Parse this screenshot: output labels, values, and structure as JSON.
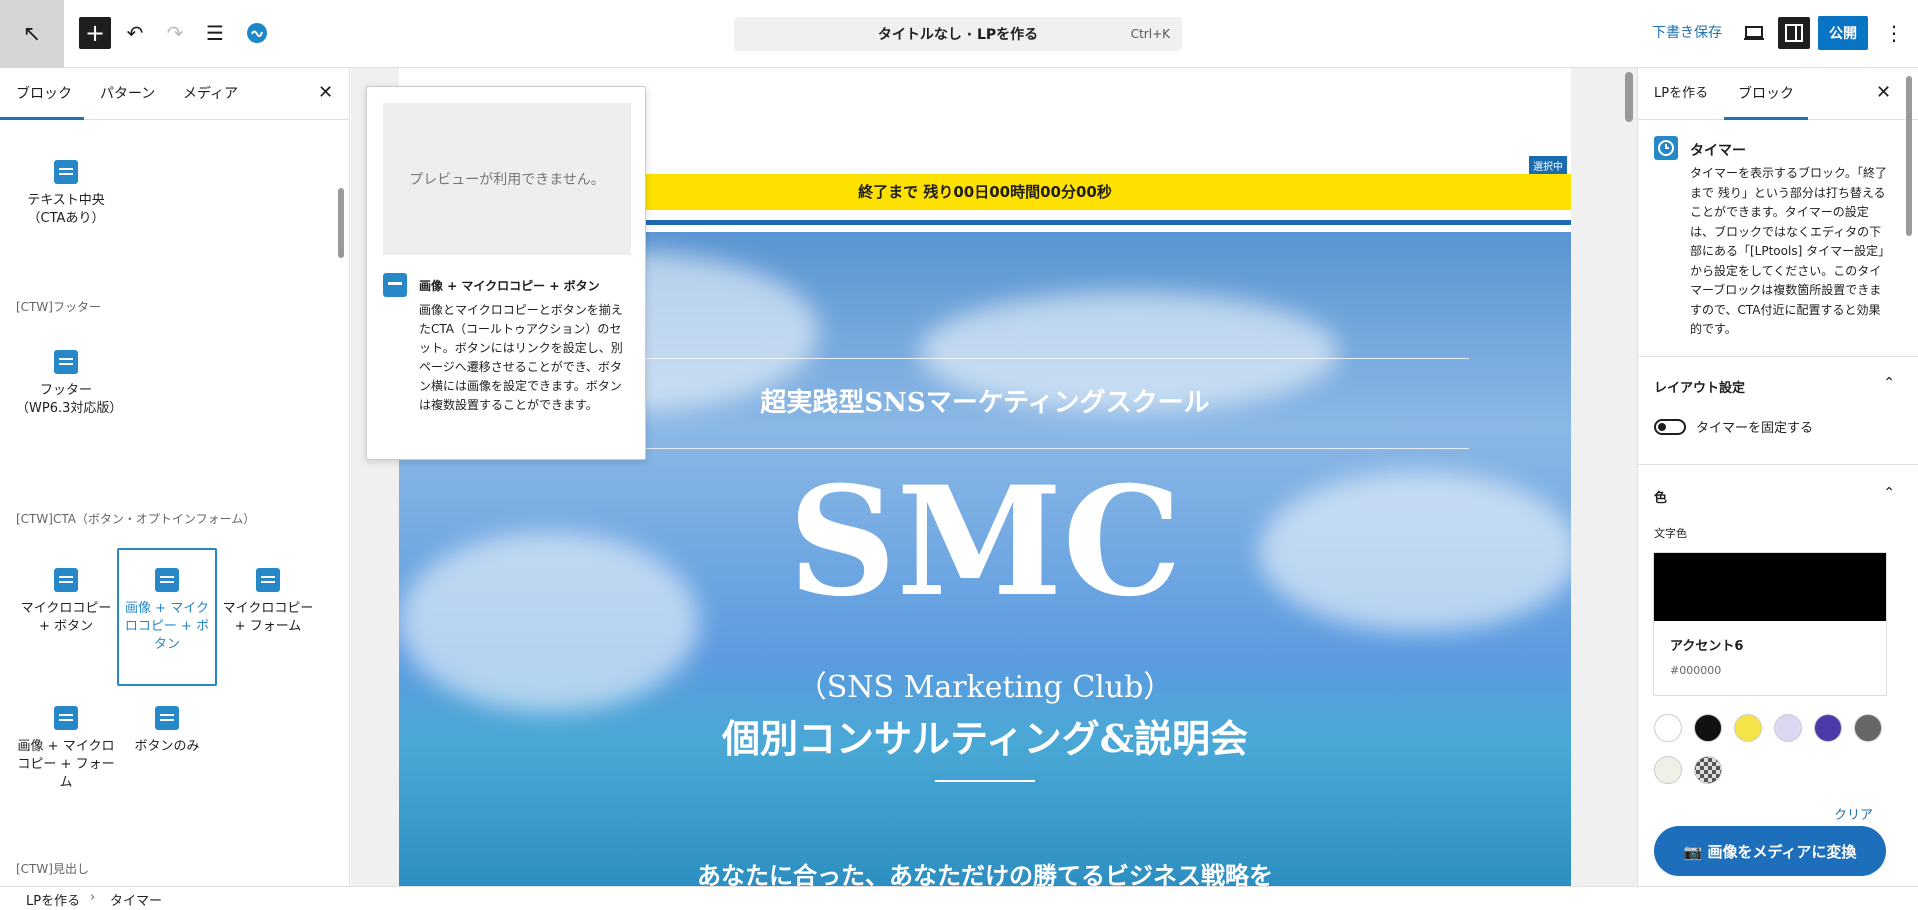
{
  "toolbar": {
    "doc_title": "タイトルなし · LPを作る",
    "doc_shortcut": "Ctrl+K",
    "save_draft": "下書き保存",
    "publish": "公開"
  },
  "left_panel": {
    "tabs": [
      "ブロック",
      "パターン",
      "メディア"
    ],
    "blocks_top": [
      "テキスト中央（CTAあり）"
    ],
    "cat_footer": "[CTW]フッター",
    "footer_block": "フッター（WP6.3対応版）",
    "cat_cta": "[CTW]CTA（ボタン・オプトインフォーム）",
    "cta_blocks": [
      "マイクロコピー + ボタン",
      "画像 + マイクロコピー + ボタン",
      "マイクロコピー + フォーム",
      "画像 + マイクロコピー + フォーム",
      "ボタンのみ"
    ],
    "cat_heading": "[CTW]見出し"
  },
  "popover": {
    "preview_unavailable": "プレビューが利用できません。",
    "title": "画像 + マイクロコピー + ボタン",
    "description": "画像とマイクロコピーとボタンを揃えたCTA（コールトゥアクション）のセット。ボタンにはリンクを設定し、別ページへ遷移させることができ、ボタン横には画像を設定できます。ボタンは複数設置することができます。"
  },
  "canvas": {
    "timer_text": "終了まで 残り00日00時間00分00秒",
    "selected_tag": "選択中",
    "hero_kicker": "超実践型SNSマーケティングスクール",
    "hero_title": "SMC",
    "hero_sub": "（SNS Marketing Club）",
    "hero_headline": "個別コンサルティング&説明会",
    "hero_bottom": "あなたに合った、あなただけの勝てるビジネス戦略を"
  },
  "right_panel": {
    "tabs": [
      "LPを作る",
      "ブロック"
    ],
    "block_title": "タイマー",
    "block_desc": "タイマーを表示するブロック。「終了まで 残り」という部分は打ち替えることができます。タイマーの設定は、ブロックではなくエディタの下部にある「[LPtools] タイマー設定」から設定をしてください。このタイマーブロックは複数箇所設置できますので、CTA付近に配置すると効果的です。",
    "layout_title": "レイアウト設定",
    "toggle_label": "タイマーを固定する",
    "color_title": "色",
    "text_color_label": "文字色",
    "color_name": "アクセント6",
    "color_hex": "#000000",
    "swatch_colors": [
      "#ffffff",
      "#111111",
      "#f5e34a",
      "#ddd6f0",
      "#4b3aa8",
      "#666666",
      "#eef2e6",
      "#999999"
    ],
    "clear": "クリア",
    "convert_button": "📷 画像をメディアに変換"
  },
  "footer": {
    "crumbs": [
      "LPを作る",
      "タイマー"
    ]
  }
}
